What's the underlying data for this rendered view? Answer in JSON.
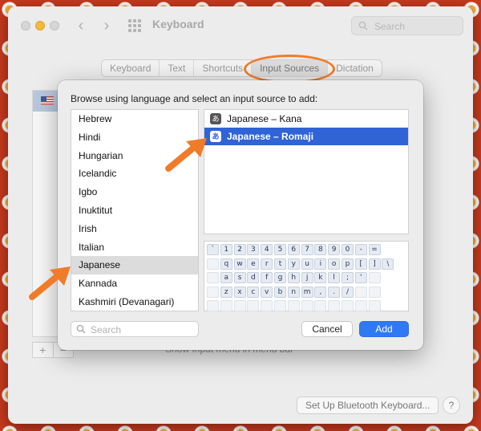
{
  "window": {
    "title": "Keyboard",
    "search_placeholder": "Search",
    "tabs": [
      {
        "label": "Keyboard"
      },
      {
        "label": "Text"
      },
      {
        "label": "Shortcuts"
      },
      {
        "label": "Input Sources",
        "active": true
      },
      {
        "label": "Dictation"
      }
    ],
    "show_menu_text": "Show Input menu in menu bar",
    "bluetooth_button": "Set Up Bluetooth Keyboard...",
    "help_button": "?"
  },
  "sheet": {
    "prompt": "Browse using language and select an input source to add:",
    "languages": [
      {
        "label": "Hebrew"
      },
      {
        "label": "Hindi"
      },
      {
        "label": "Hungarian"
      },
      {
        "label": "Icelandic"
      },
      {
        "label": "Igbo"
      },
      {
        "label": "Inuktitut"
      },
      {
        "label": "Irish"
      },
      {
        "label": "Italian"
      },
      {
        "label": "Japanese",
        "selected": true
      },
      {
        "label": "Kannada"
      },
      {
        "label": "Kashmiri (Devanagari)"
      }
    ],
    "sources": [
      {
        "icon_glyph": "あ",
        "label": "Japanese – Kana"
      },
      {
        "icon_glyph": "あ",
        "label": "Japanese – Romaji",
        "selected": true
      }
    ],
    "keyboard_rows": [
      [
        "`",
        "1",
        "2",
        "3",
        "4",
        "5",
        "6",
        "7",
        "8",
        "9",
        "0",
        "-",
        "="
      ],
      [
        "",
        "q",
        "w",
        "e",
        "r",
        "t",
        "y",
        "u",
        "i",
        "o",
        "p",
        "[",
        "]",
        "\\"
      ],
      [
        "",
        "a",
        "s",
        "d",
        "f",
        "g",
        "h",
        "j",
        "k",
        "l",
        ";",
        "'",
        ""
      ],
      [
        "",
        "z",
        "x",
        "c",
        "v",
        "b",
        "n",
        "m",
        ",",
        ".",
        "/",
        "",
        ""
      ],
      [
        "",
        "",
        "",
        "",
        "",
        "",
        "",
        "",
        "",
        "",
        "",
        "",
        ""
      ]
    ],
    "search_placeholder": "Search",
    "cancel_label": "Cancel",
    "add_label": "Add"
  },
  "colors": {
    "accent": "#2f63d6",
    "add_button": "#2f7af3",
    "annotation": "#f07c2a"
  },
  "icons": [
    "search-icon",
    "grid-icon",
    "back-icon",
    "forward-icon",
    "flag-icon",
    "kana-icon"
  ]
}
